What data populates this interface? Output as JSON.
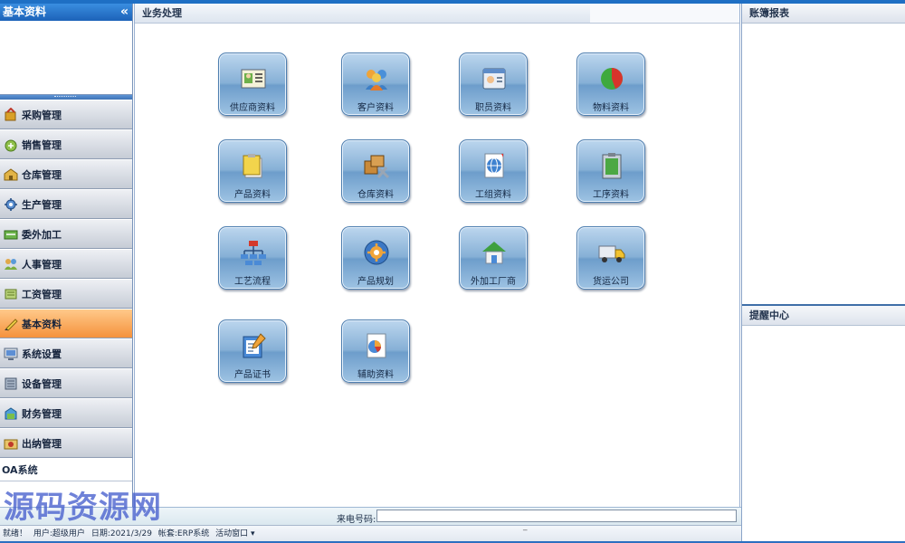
{
  "sidebar": {
    "title": "基本资料",
    "collapse_glyph": "«",
    "items": [
      {
        "label": "采购管理",
        "icon": "purchase-icon"
      },
      {
        "label": "销售管理",
        "icon": "sales-icon"
      },
      {
        "label": "仓库管理",
        "icon": "warehouse-icon"
      },
      {
        "label": "生产管理",
        "icon": "production-icon"
      },
      {
        "label": "委外加工",
        "icon": "outsourcing-icon"
      },
      {
        "label": "人事管理",
        "icon": "personnel-icon"
      },
      {
        "label": "工资管理",
        "icon": "payroll-icon"
      },
      {
        "label": "基本资料",
        "icon": "basic-data-icon",
        "active": true
      },
      {
        "label": "系统设置",
        "icon": "system-settings-icon"
      },
      {
        "label": "设备管理",
        "icon": "equipment-icon"
      },
      {
        "label": "财务管理",
        "icon": "finance-icon"
      },
      {
        "label": "出纳管理",
        "icon": "cashier-icon"
      }
    ],
    "oa_label": "OA系统"
  },
  "main": {
    "title": "业务处理",
    "tiles": [
      {
        "label": "供应商资料",
        "icon": "supplier-card-icon"
      },
      {
        "label": "客户资料",
        "icon": "customers-icon"
      },
      {
        "label": "职员资料",
        "icon": "employee-card-icon"
      },
      {
        "label": "物料资料",
        "icon": "material-pie-icon"
      },
      {
        "label": "产品资料",
        "icon": "product-folder-icon"
      },
      {
        "label": "仓库资料",
        "icon": "warehouse-tools-icon"
      },
      {
        "label": "工组资料",
        "icon": "workgroup-globe-icon"
      },
      {
        "label": "工序资料",
        "icon": "process-clipboard-icon"
      },
      {
        "label": "工艺流程",
        "icon": "flowchart-icon"
      },
      {
        "label": "产品规划",
        "icon": "planning-gear-icon"
      },
      {
        "label": "外加工厂商",
        "icon": "factory-house-icon"
      },
      {
        "label": "货运公司",
        "icon": "truck-icon"
      },
      {
        "label": "产品证书",
        "icon": "certificate-icon"
      },
      {
        "label": "辅助资料",
        "icon": "auxiliary-chart-icon"
      }
    ]
  },
  "right_panel": {
    "top_title": "账簿报表",
    "bottom_title": "提醒中心"
  },
  "phone_bar": {
    "label": "来电号码:",
    "value": ""
  },
  "status_bar": {
    "items": [
      "就绪！",
      "用户:超级用户",
      "日期:2021/3/29",
      "帐套:ERP系统",
      "活动窗口 ▾"
    ]
  },
  "watermark": "源码资源网",
  "colors": {
    "accent_blue": "#1e6fc4",
    "active_menu": "#f5923c",
    "tile_blue": "#86b0d6"
  }
}
